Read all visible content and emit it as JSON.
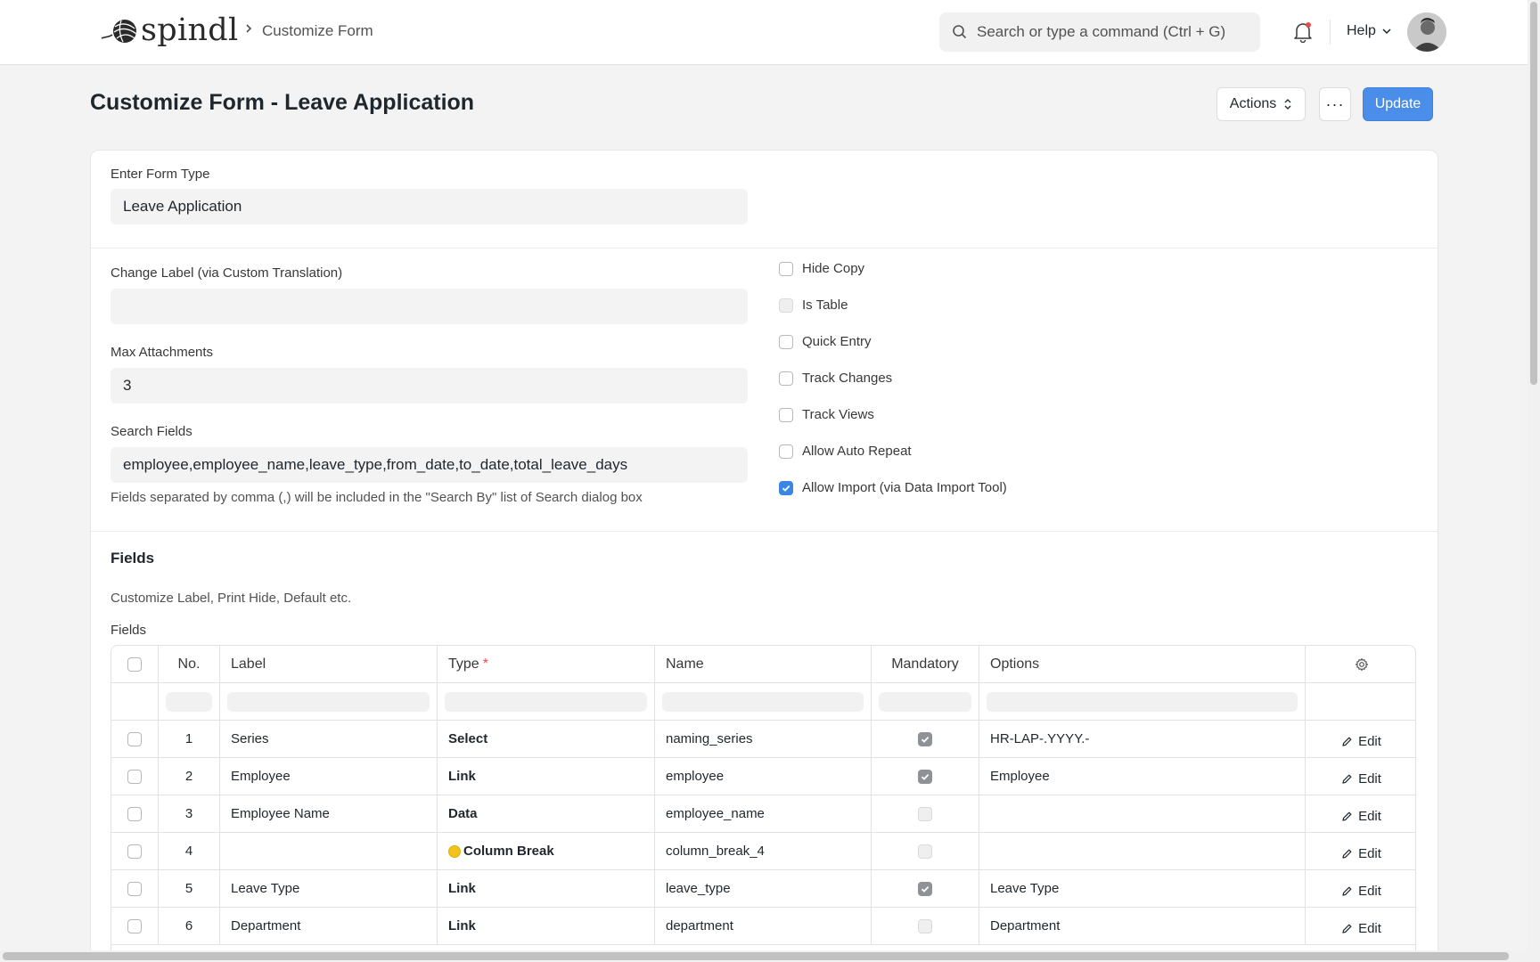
{
  "navbar": {
    "logo_text": "spindl",
    "breadcrumb": "Customize Form",
    "search_placeholder": "Search or type a command (Ctrl + G)",
    "help_label": "Help"
  },
  "page": {
    "title": "Customize Form - Leave Application",
    "actions_label": "Actions",
    "more_label": "···",
    "update_label": "Update"
  },
  "form": {
    "form_type_label": "Enter Form Type",
    "form_type_value": "Leave Application",
    "change_label_label": "Change Label (via Custom Translation)",
    "change_label_value": "",
    "max_attachments_label": "Max Attachments",
    "max_attachments_value": "3",
    "search_fields_label": "Search Fields",
    "search_fields_value": "employee,employee_name,leave_type,from_date,to_date,total_leave_days",
    "search_fields_hint": "Fields separated by comma (,) will be included in the \"Search By\" list of Search dialog box",
    "checkboxes": [
      {
        "label": "Hide Copy",
        "checked": false,
        "disabled": false
      },
      {
        "label": "Is Table",
        "checked": false,
        "disabled": true
      },
      {
        "label": "Quick Entry",
        "checked": false,
        "disabled": false
      },
      {
        "label": "Track Changes",
        "checked": false,
        "disabled": false
      },
      {
        "label": "Track Views",
        "checked": false,
        "disabled": false
      },
      {
        "label": "Allow Auto Repeat",
        "checked": false,
        "disabled": false
      },
      {
        "label": "Allow Import (via Data Import Tool)",
        "checked": true,
        "disabled": false
      }
    ]
  },
  "fields_section": {
    "title": "Fields",
    "description": "Customize Label, Print Hide, Default etc.",
    "sub_label": "Fields",
    "columns": {
      "no": "No.",
      "label": "Label",
      "type": "Type",
      "required_mark": "*",
      "name": "Name",
      "mandatory": "Mandatory",
      "options": "Options"
    },
    "edit_label": "Edit",
    "rows": [
      {
        "no": "1",
        "label": "Series",
        "type": "Select",
        "name": "naming_series",
        "mandatory": true,
        "options": "HR-LAP-.YYYY.-"
      },
      {
        "no": "2",
        "label": "Employee",
        "type": "Link",
        "name": "employee",
        "mandatory": true,
        "options": "Employee"
      },
      {
        "no": "3",
        "label": "Employee Name",
        "type": "Data",
        "name": "employee_name",
        "mandatory": false,
        "options": ""
      },
      {
        "no": "4",
        "label": "",
        "type": "Column Break",
        "name": "column_break_4",
        "mandatory": false,
        "options": "",
        "indicator": "yellow"
      },
      {
        "no": "5",
        "label": "Leave Type",
        "type": "Link",
        "name": "leave_type",
        "mandatory": true,
        "options": "Leave Type"
      },
      {
        "no": "6",
        "label": "Department",
        "type": "Link",
        "name": "department",
        "mandatory": false,
        "options": "Department"
      }
    ]
  },
  "colors": {
    "primary": "#4a8ee9",
    "checkbox_checked": "#3a86e5",
    "indicator_yellow": "#f2c21b"
  }
}
